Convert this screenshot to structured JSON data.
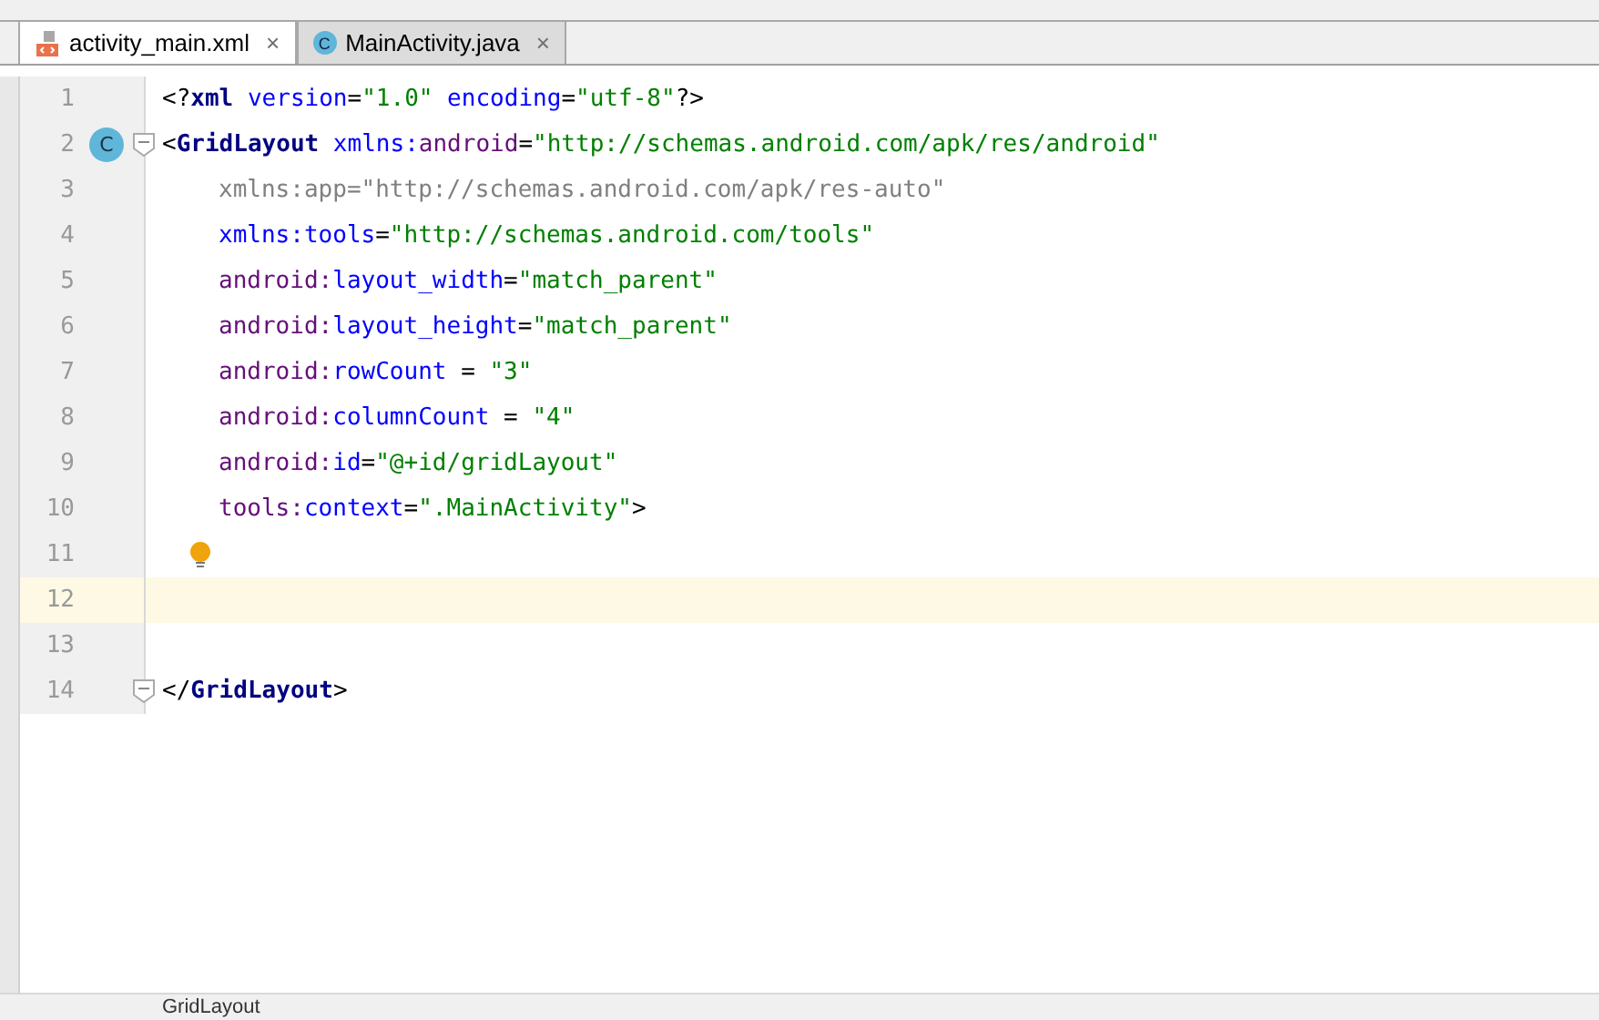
{
  "tabs": [
    {
      "label": "activity_main.xml",
      "kind": "xml",
      "selected": true,
      "close": "×"
    },
    {
      "label": "MainActivity.java",
      "kind": "class",
      "icon_letter": "C",
      "selected": false,
      "close": "×"
    }
  ],
  "editor": {
    "lines": [
      {
        "number": "1",
        "kind": "tag",
        "current": false,
        "tokens": [
          {
            "t": "<?",
            "kind": "punct"
          },
          {
            "t": "xml",
            "kind": "keyword"
          },
          {
            "t": " version",
            "kind": "attr"
          },
          {
            "t": "=",
            "kind": "punct"
          },
          {
            "t": "\"1.0\"",
            "kind": "value"
          },
          {
            "t": " encoding",
            "kind": "attr"
          },
          {
            "t": "=",
            "kind": "punct"
          },
          {
            "t": "\"utf-8\"",
            "kind": "value"
          },
          {
            "t": "?>",
            "kind": "punct"
          }
        ]
      },
      {
        "number": "2",
        "kind": "tag",
        "current": false,
        "badge": "C",
        "fold": true,
        "tokens": [
          {
            "t": "<",
            "kind": "punct"
          },
          {
            "t": "GridLayout",
            "kind": "keyword"
          },
          {
            "t": " xmlns:",
            "kind": "attr"
          },
          {
            "t": "android",
            "kind": "ns"
          },
          {
            "t": "=",
            "kind": "punct"
          },
          {
            "t": "\"http://schemas.android.com/apk/res/android\"",
            "kind": "value"
          }
        ]
      },
      {
        "number": "3",
        "kind": "attribute",
        "current": false,
        "tokens": [
          {
            "t": "xmlns:app=\"http://schemas.android.com/apk/res-auto\"",
            "kind": "unused"
          }
        ]
      },
      {
        "number": "4",
        "kind": "attribute",
        "current": false,
        "tokens": [
          {
            "t": "xmlns:tools",
            "kind": "attr"
          },
          {
            "t": "=",
            "kind": "punct"
          },
          {
            "t": "\"http://schemas.android.com/tools\"",
            "kind": "value"
          }
        ]
      },
      {
        "number": "5",
        "kind": "attribute",
        "current": false,
        "tokens": [
          {
            "t": "android:",
            "kind": "ns"
          },
          {
            "t": "layout_width",
            "kind": "attr"
          },
          {
            "t": "=",
            "kind": "punct"
          },
          {
            "t": "\"match_parent\"",
            "kind": "value"
          }
        ]
      },
      {
        "number": "6",
        "kind": "attribute",
        "current": false,
        "tokens": [
          {
            "t": "android:",
            "kind": "ns"
          },
          {
            "t": "layout_height",
            "kind": "attr"
          },
          {
            "t": "=",
            "kind": "punct"
          },
          {
            "t": "\"match_parent\"",
            "kind": "value"
          }
        ]
      },
      {
        "number": "7",
        "kind": "attribute",
        "current": false,
        "tokens": [
          {
            "t": "android:",
            "kind": "ns"
          },
          {
            "t": "rowCount",
            "kind": "attr"
          },
          {
            "t": " = ",
            "kind": "punct"
          },
          {
            "t": "\"3\"",
            "kind": "value"
          }
        ]
      },
      {
        "number": "8",
        "kind": "attribute",
        "current": false,
        "tokens": [
          {
            "t": "android:",
            "kind": "ns"
          },
          {
            "t": "columnCount",
            "kind": "attr"
          },
          {
            "t": " = ",
            "kind": "punct"
          },
          {
            "t": "\"4\"",
            "kind": "value"
          }
        ]
      },
      {
        "number": "9",
        "kind": "attribute",
        "current": false,
        "tokens": [
          {
            "t": "android:",
            "kind": "ns"
          },
          {
            "t": "id",
            "kind": "attr"
          },
          {
            "t": "=",
            "kind": "punct"
          },
          {
            "t": "\"@+id/gridLayout\"",
            "kind": "value"
          }
        ]
      },
      {
        "number": "10",
        "kind": "attribute",
        "current": false,
        "tokens": [
          {
            "t": "tools:",
            "kind": "ns"
          },
          {
            "t": "context",
            "kind": "attr"
          },
          {
            "t": "=",
            "kind": "punct"
          },
          {
            "t": "\".MainActivity\"",
            "kind": "value"
          },
          {
            "t": ">",
            "kind": "punct"
          }
        ]
      },
      {
        "number": "11",
        "kind": "blank",
        "current": false,
        "bulb": true
      },
      {
        "number": "12",
        "kind": "blank",
        "current": true
      },
      {
        "number": "13",
        "kind": "blank",
        "current": false
      },
      {
        "number": "14",
        "kind": "tag",
        "current": false,
        "fold": true,
        "tokens": [
          {
            "t": "</",
            "kind": "punct"
          },
          {
            "t": "GridLayout",
            "kind": "keyword"
          },
          {
            "t": ">",
            "kind": "punct"
          }
        ]
      }
    ]
  },
  "breadcrumb": "GridLayout"
}
